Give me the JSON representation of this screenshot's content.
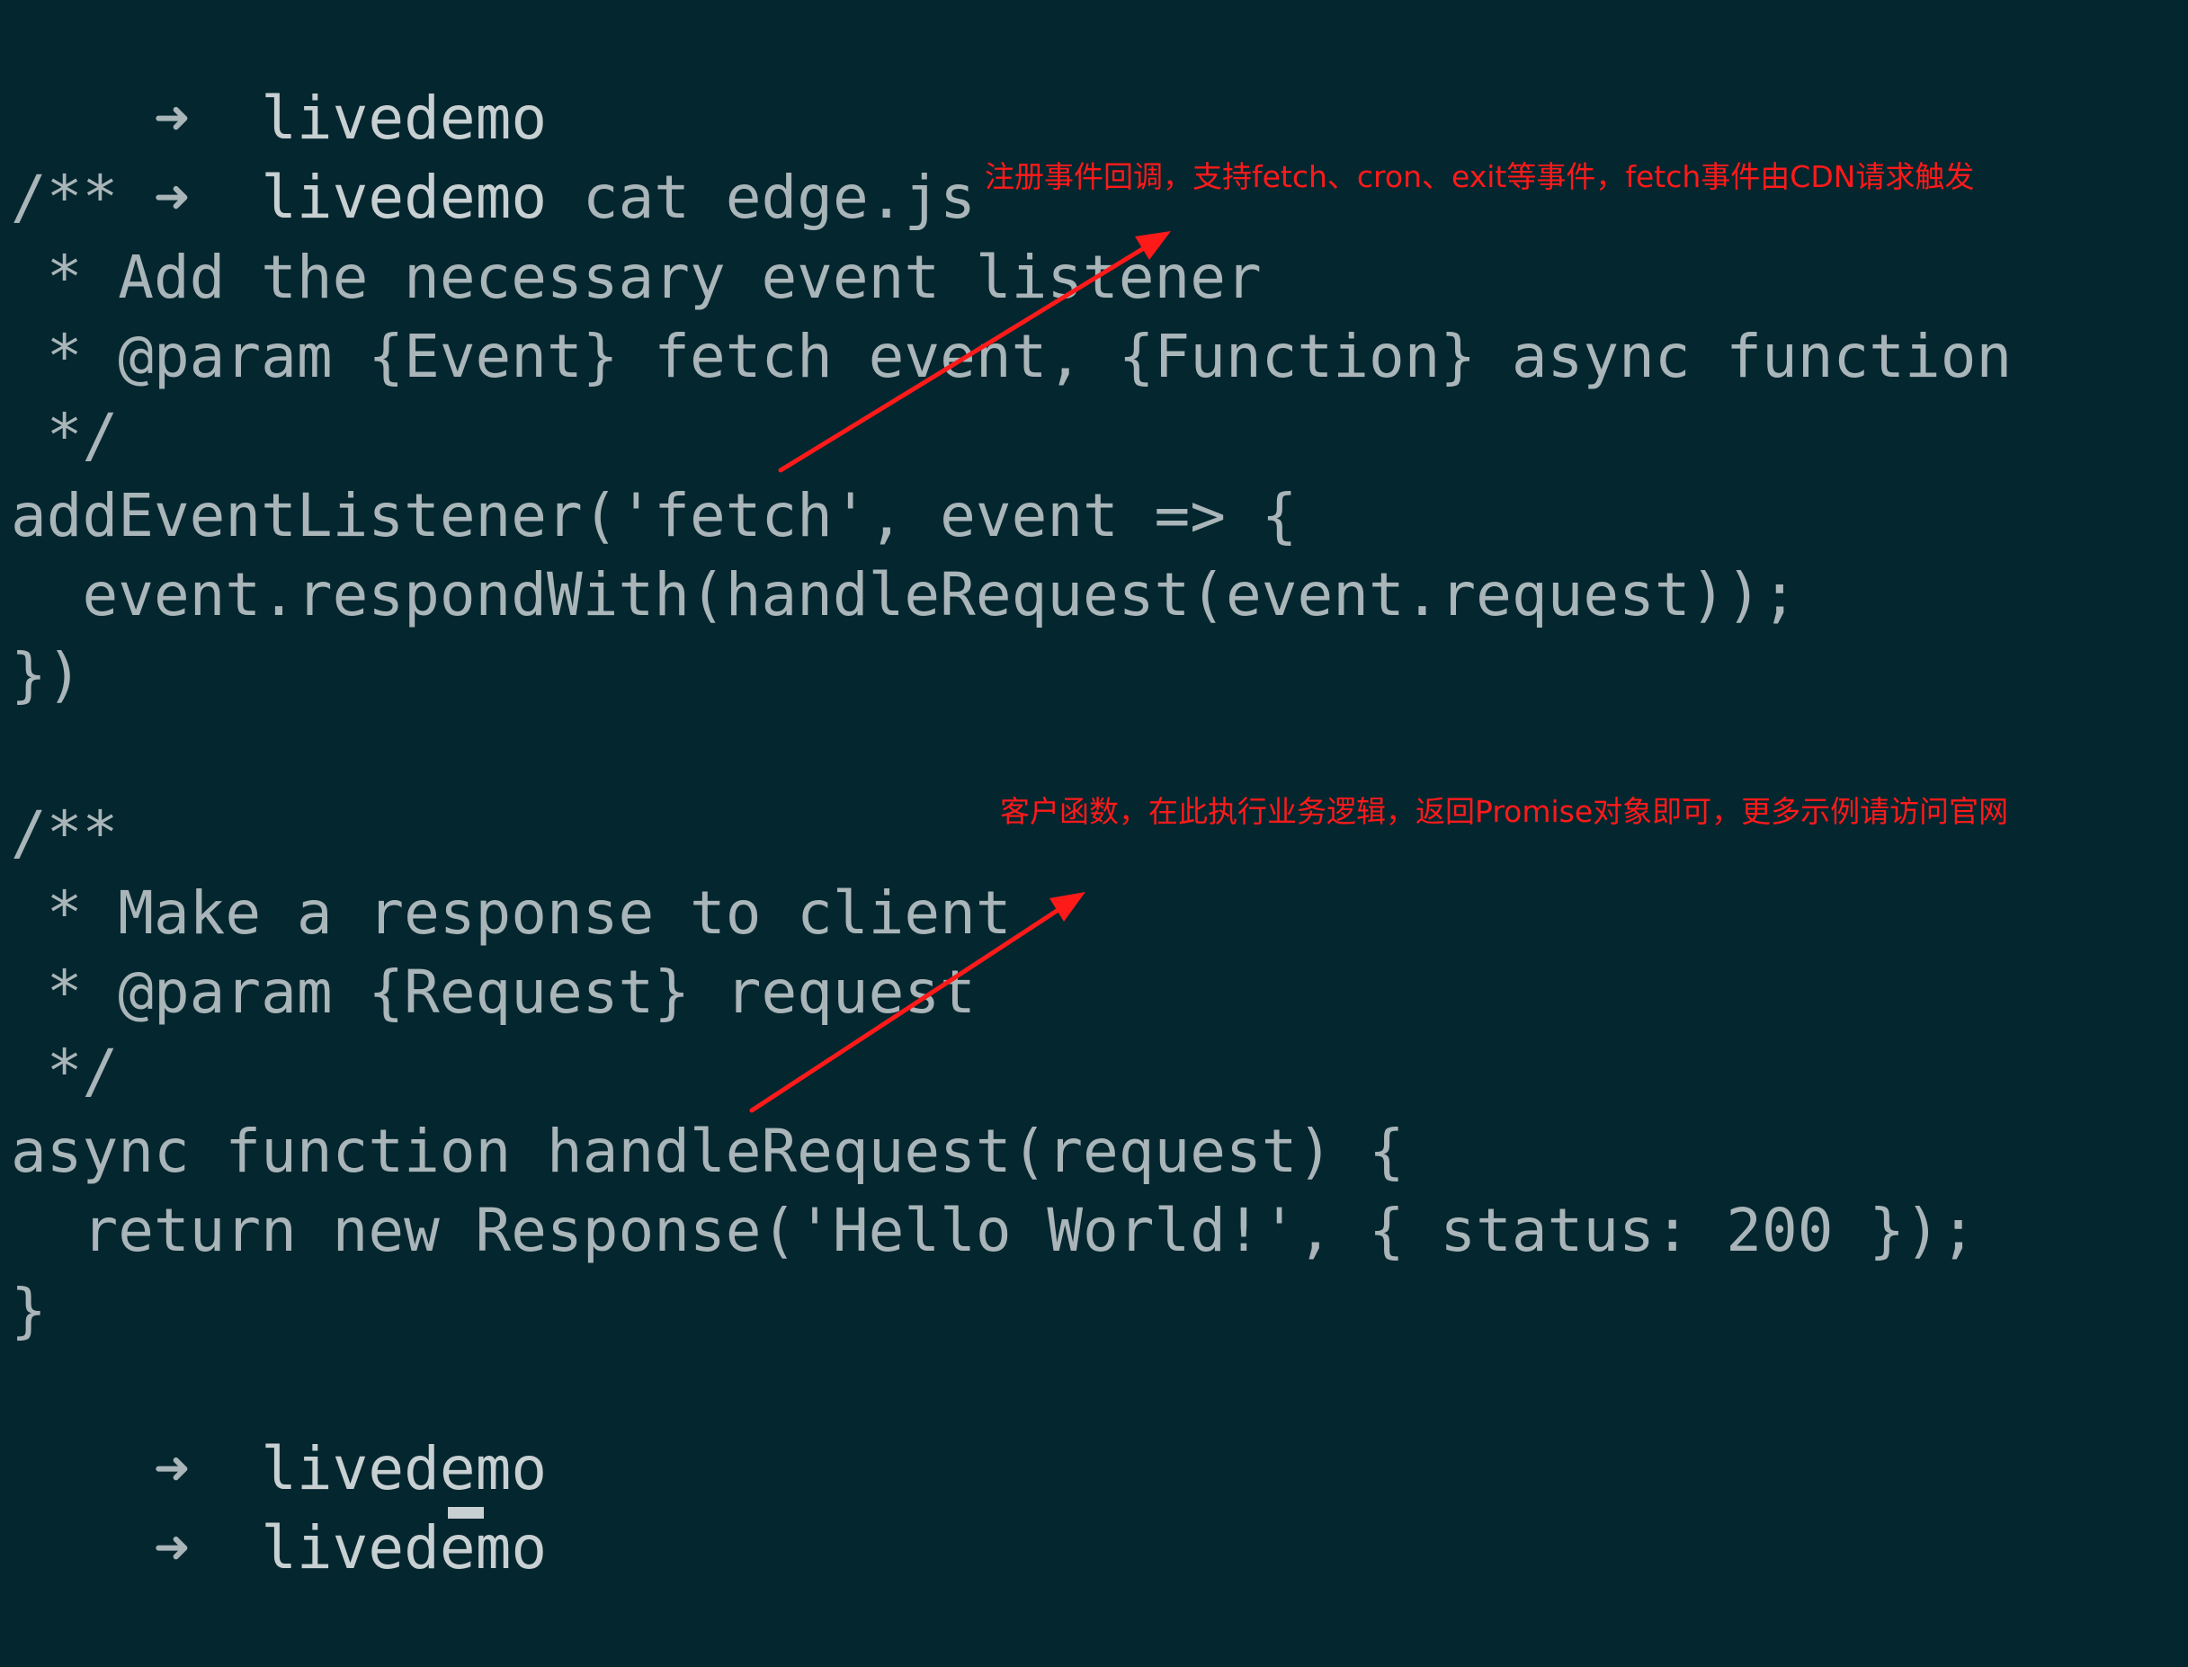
{
  "terminal": {
    "prompt_symbol": "➜",
    "lines": [
      {
        "kind": "prompt",
        "dir": "livedemo",
        "command": ""
      },
      {
        "kind": "prompt",
        "dir": "livedemo",
        "command": "cat edge.js"
      },
      {
        "kind": "code",
        "text": "/**"
      },
      {
        "kind": "code",
        "text": " * Add the necessary event listener"
      },
      {
        "kind": "code",
        "text": " * @param {Event} fetch event, {Function} async function"
      },
      {
        "kind": "code",
        "text": " */"
      },
      {
        "kind": "code",
        "text": "addEventListener('fetch', event => {"
      },
      {
        "kind": "code",
        "text": "  event.respondWith(handleRequest(event.request));"
      },
      {
        "kind": "code",
        "text": "})"
      },
      {
        "kind": "code",
        "text": ""
      },
      {
        "kind": "code",
        "text": "/**"
      },
      {
        "kind": "code",
        "text": " * Make a response to client"
      },
      {
        "kind": "code",
        "text": " * @param {Request} request"
      },
      {
        "kind": "code",
        "text": " */"
      },
      {
        "kind": "code",
        "text": "async function handleRequest(request) {"
      },
      {
        "kind": "code",
        "text": "  return new Response('Hello World!', { status: 200 });"
      },
      {
        "kind": "code",
        "text": "}"
      },
      {
        "kind": "prompt",
        "dir": "livedemo",
        "command": ""
      },
      {
        "kind": "prompt",
        "dir": "livedemo",
        "command": ""
      }
    ]
  },
  "annotations": {
    "first": "注册事件回调，支持fetch、cron、exit等事件，fetch事件由CDN请求触发",
    "second": "客户函数，在此执行业务逻辑，返回Promise对象即可，更多示例请访问官网"
  },
  "colors": {
    "background": "#04262f",
    "text": "#a9b5b8",
    "annotation": "#ff1a1a"
  }
}
